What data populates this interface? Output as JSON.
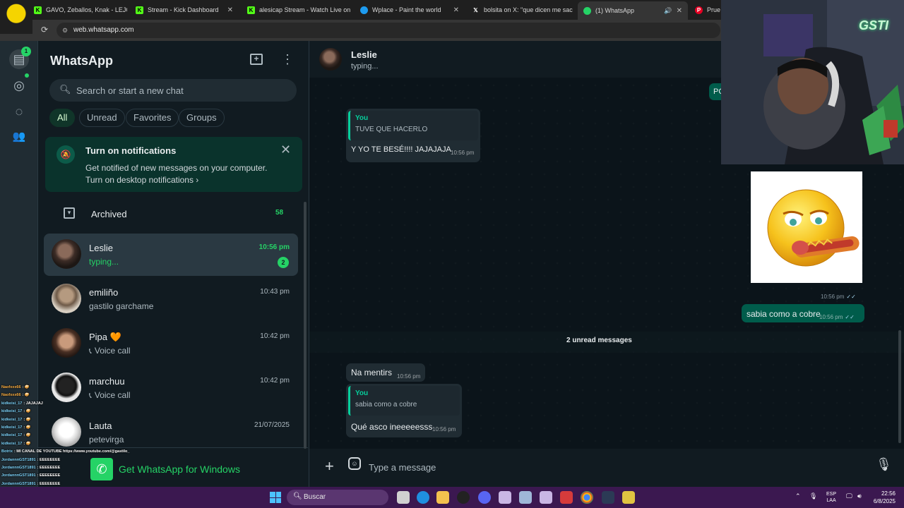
{
  "browser": {
    "tabs": [
      {
        "label": "GAVO, Zeballos, Knak - LEJO",
        "icon": "kick-icon"
      },
      {
        "label": "Stream - Kick Dashboard",
        "icon": "kick-icon"
      },
      {
        "label": "alesicap Stream - Watch Live on",
        "icon": "kick-icon"
      },
      {
        "label": "Wplace - Paint the world",
        "icon": "globe-icon"
      },
      {
        "label": "bolsita on X: \"que dicen me sac",
        "icon": "x-icon"
      },
      {
        "label": "(1) WhatsApp",
        "icon": "whatsapp-icon"
      },
      {
        "label": "Prueba",
        "icon": "pinterest-icon"
      }
    ],
    "url": "web.whatsapp.com"
  },
  "rail": {
    "chats_badge": "1"
  },
  "sidebar": {
    "title": "WhatsApp",
    "search_placeholder": "Search or start a new chat",
    "filters": [
      "All",
      "Unread",
      "Favorites",
      "Groups"
    ],
    "notification": {
      "title": "Turn on notifications",
      "body": "Get notified of new messages on your computer.",
      "link": "Turn on desktop notifications ›"
    },
    "archived": {
      "label": "Archived",
      "count": "58"
    },
    "chats": [
      {
        "name": "Leslie",
        "preview": "typing...",
        "time": "10:56 pm",
        "unread": "2"
      },
      {
        "name": "emiliño",
        "preview": "gastilo garchame",
        "time": "10:43 pm"
      },
      {
        "name": "Pipa 🧡",
        "preview": "Voice call",
        "time": "10:42 pm"
      },
      {
        "name": "marchuu",
        "preview": "Voice call",
        "time": "10:42 pm"
      },
      {
        "name": "Lauta",
        "preview": "petevirga",
        "time": "21/07/2025"
      }
    ],
    "get_app": "Get WhatsApp for Windows"
  },
  "chat": {
    "contact": "Leslie",
    "status": "typing...",
    "messages": [
      {
        "dir": "in",
        "quote_from": "You",
        "quote_text": "TUVE QUE HACERLO",
        "text": "Y YO TE BESÉ!!!! JAJAJAJA",
        "time": "10:56 pm"
      },
      {
        "dir": "out",
        "text": "sabia como a cobre",
        "time": "10:56 pm"
      },
      {
        "dir": "in",
        "text": "Na mentirs",
        "time": "10:56 pm"
      },
      {
        "dir": "in",
        "quote_from": "You",
        "quote_text": "sabia como a cobre",
        "text": "Qué asco ineeeeesss",
        "time": "10:56 pm"
      }
    ],
    "sticker_time": "10:56 pm",
    "partial_bubble": "PC",
    "unread_divider": "2 unread messages",
    "composer_placeholder": "Type a message"
  },
  "stream": {
    "overlay_logo": "GSTI",
    "chat_lines": [
      {
        "user": "Naofxxx66",
        "text": ": 🥪"
      },
      {
        "user": "Naofxxx66",
        "text": ": 🥪"
      },
      {
        "user": "kidkeisi_17",
        "text": ": JAJAJAJ"
      },
      {
        "user": "kidkeisi_17",
        "text": ": 🥪"
      },
      {
        "user": "kidkeisi_17",
        "text": ": 🥪"
      },
      {
        "user": "kidkeisi_17",
        "text": ": 🥪"
      },
      {
        "user": "kidkeisi_17",
        "text": ": 🥪"
      },
      {
        "user": "kidkeisi_17",
        "text": ": 🥪"
      },
      {
        "user": "Botrix",
        "text": ": MI CANAL DE YOUTUBE https://www.youtube.com/@gastilo_"
      },
      {
        "user": "JordannnGST1891",
        "text": ": EEEEEEEE"
      },
      {
        "user": "JordannnGST1891",
        "text": ": EEEEEEEE"
      },
      {
        "user": "JordannnGST1891",
        "text": ": EEEEEEEE"
      },
      {
        "user": "JordannnGST1891",
        "text": ": EEEEEEEE"
      },
      {
        "user": "JordannnGST1891",
        "text": ": EEEEEEEE"
      },
      {
        "user": "JordannnGST1891",
        "text": ": EEEEEEEE"
      },
      {
        "user": "JordannnGST1891",
        "text": ": EEEEEEEE"
      }
    ]
  },
  "taskbar": {
    "search_label": "Buscar",
    "language": [
      "ESP",
      "LAA"
    ],
    "time": "22:56",
    "date": "6/8/2025"
  },
  "colors": {
    "accent": "#25d366",
    "outgoing_bubble": "#005c4b",
    "incoming_bubble": "#202c33",
    "panel": "#111b21"
  }
}
